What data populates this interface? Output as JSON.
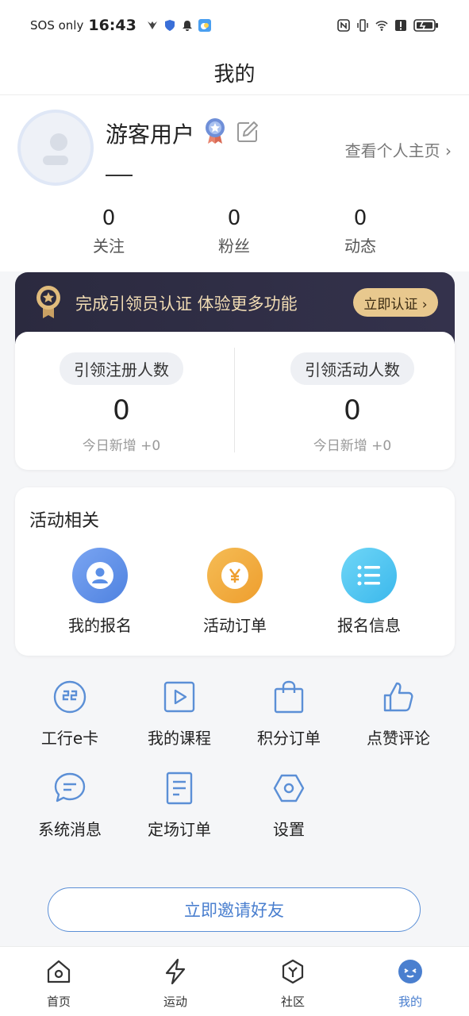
{
  "status_bar": {
    "carrier": "SOS only",
    "time": "16:43"
  },
  "nav": {
    "title": "我的"
  },
  "profile": {
    "username": "游客用户",
    "view_home": "查看个人主页 ›",
    "stats": [
      {
        "value": "0",
        "label": "关注"
      },
      {
        "value": "0",
        "label": "粉丝"
      },
      {
        "value": "0",
        "label": "动态"
      }
    ]
  },
  "cert_banner": {
    "text": "完成引领员认证 体验更多功能",
    "button": "立即认证 ›"
  },
  "leader_stats": [
    {
      "title": "引领注册人数",
      "value": "0",
      "sub": "今日新增 +0"
    },
    {
      "title": "引领活动人数",
      "value": "0",
      "sub": "今日新增 +0"
    }
  ],
  "activity": {
    "title": "活动相关",
    "items": [
      {
        "label": "我的报名",
        "icon": "user-icon",
        "color": "#5b8fe6"
      },
      {
        "label": "活动订单",
        "icon": "yen-icon",
        "color": "#f0a73a"
      },
      {
        "label": "报名信息",
        "icon": "list-icon",
        "color": "#4cc3ef"
      }
    ]
  },
  "menu": [
    {
      "label": "工行e卡",
      "icon": "card-icon"
    },
    {
      "label": "我的课程",
      "icon": "play-icon"
    },
    {
      "label": "积分订单",
      "icon": "bag-icon"
    },
    {
      "label": "点赞评论",
      "icon": "thumbs-up-icon"
    },
    {
      "label": "系统消息",
      "icon": "message-icon"
    },
    {
      "label": "定场订单",
      "icon": "document-icon"
    },
    {
      "label": "设置",
      "icon": "settings-icon"
    }
  ],
  "invite_button": "立即邀请好友",
  "tabs": [
    {
      "label": "首页",
      "icon": "home-icon",
      "active": false
    },
    {
      "label": "运动",
      "icon": "lightning-icon",
      "active": false
    },
    {
      "label": "社区",
      "icon": "community-icon",
      "active": false
    },
    {
      "label": "我的",
      "icon": "profile-face-icon",
      "active": true
    }
  ],
  "colors": {
    "accent": "#4a7fcf",
    "icon_blue": "#5b8fd6",
    "banner_bg": "#2b2a3f",
    "banner_gold": "#e8c88e"
  }
}
